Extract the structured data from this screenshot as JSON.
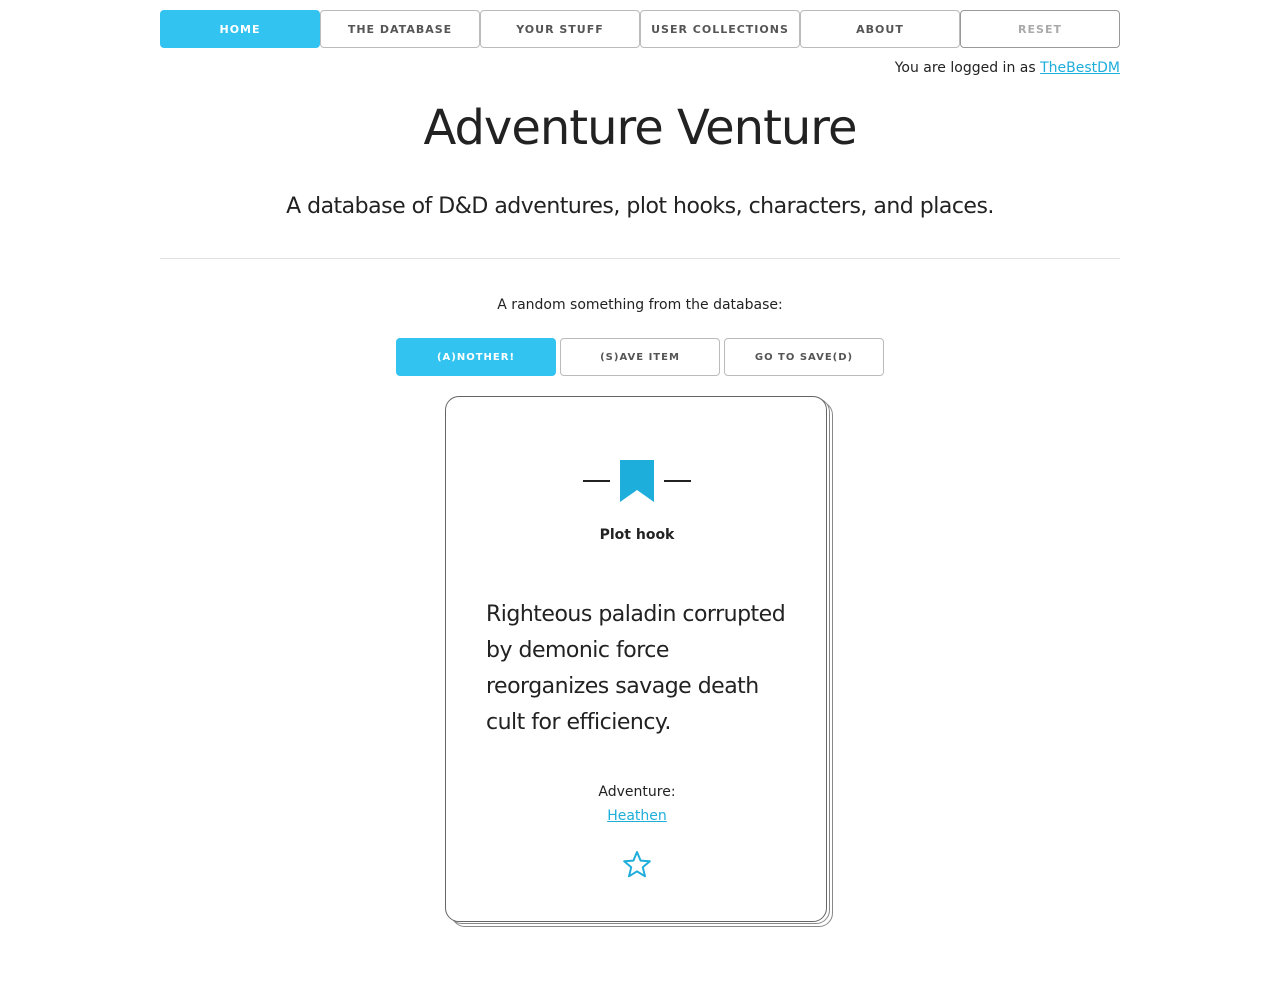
{
  "nav": {
    "items": [
      {
        "label": "HOME",
        "active": true
      },
      {
        "label": "THE DATABASE",
        "active": false
      },
      {
        "label": "YOUR STUFF",
        "active": false
      },
      {
        "label": "USER COLLECTIONS",
        "active": false
      },
      {
        "label": "ABOUT",
        "active": false
      },
      {
        "label": "RESET",
        "active": false
      }
    ]
  },
  "login": {
    "prefix": "You are logged in as ",
    "username": "TheBestDM"
  },
  "header": {
    "title": "Adventure Venture",
    "subtitle": "A database of D&D adventures, plot hooks, characters, and places."
  },
  "random": {
    "label": "A random something from the database:",
    "another_label": "(A)NOTHER!",
    "save_label": "(S)AVE ITEM",
    "goto_label": "GO TO SAVE(D)"
  },
  "card": {
    "icon": "bookmark-icon",
    "type": "Plot hook",
    "text": "Righteous paladin corrupted by demonic force reorganizes savage death cult for efficiency.",
    "adventure_label": "Adventure:",
    "adventure_name": "Heathen",
    "favorite_icon": "star-outline-icon"
  },
  "colors": {
    "accent": "#33c3f0",
    "link": "#1eaedb",
    "icon": "#1eaedb"
  }
}
